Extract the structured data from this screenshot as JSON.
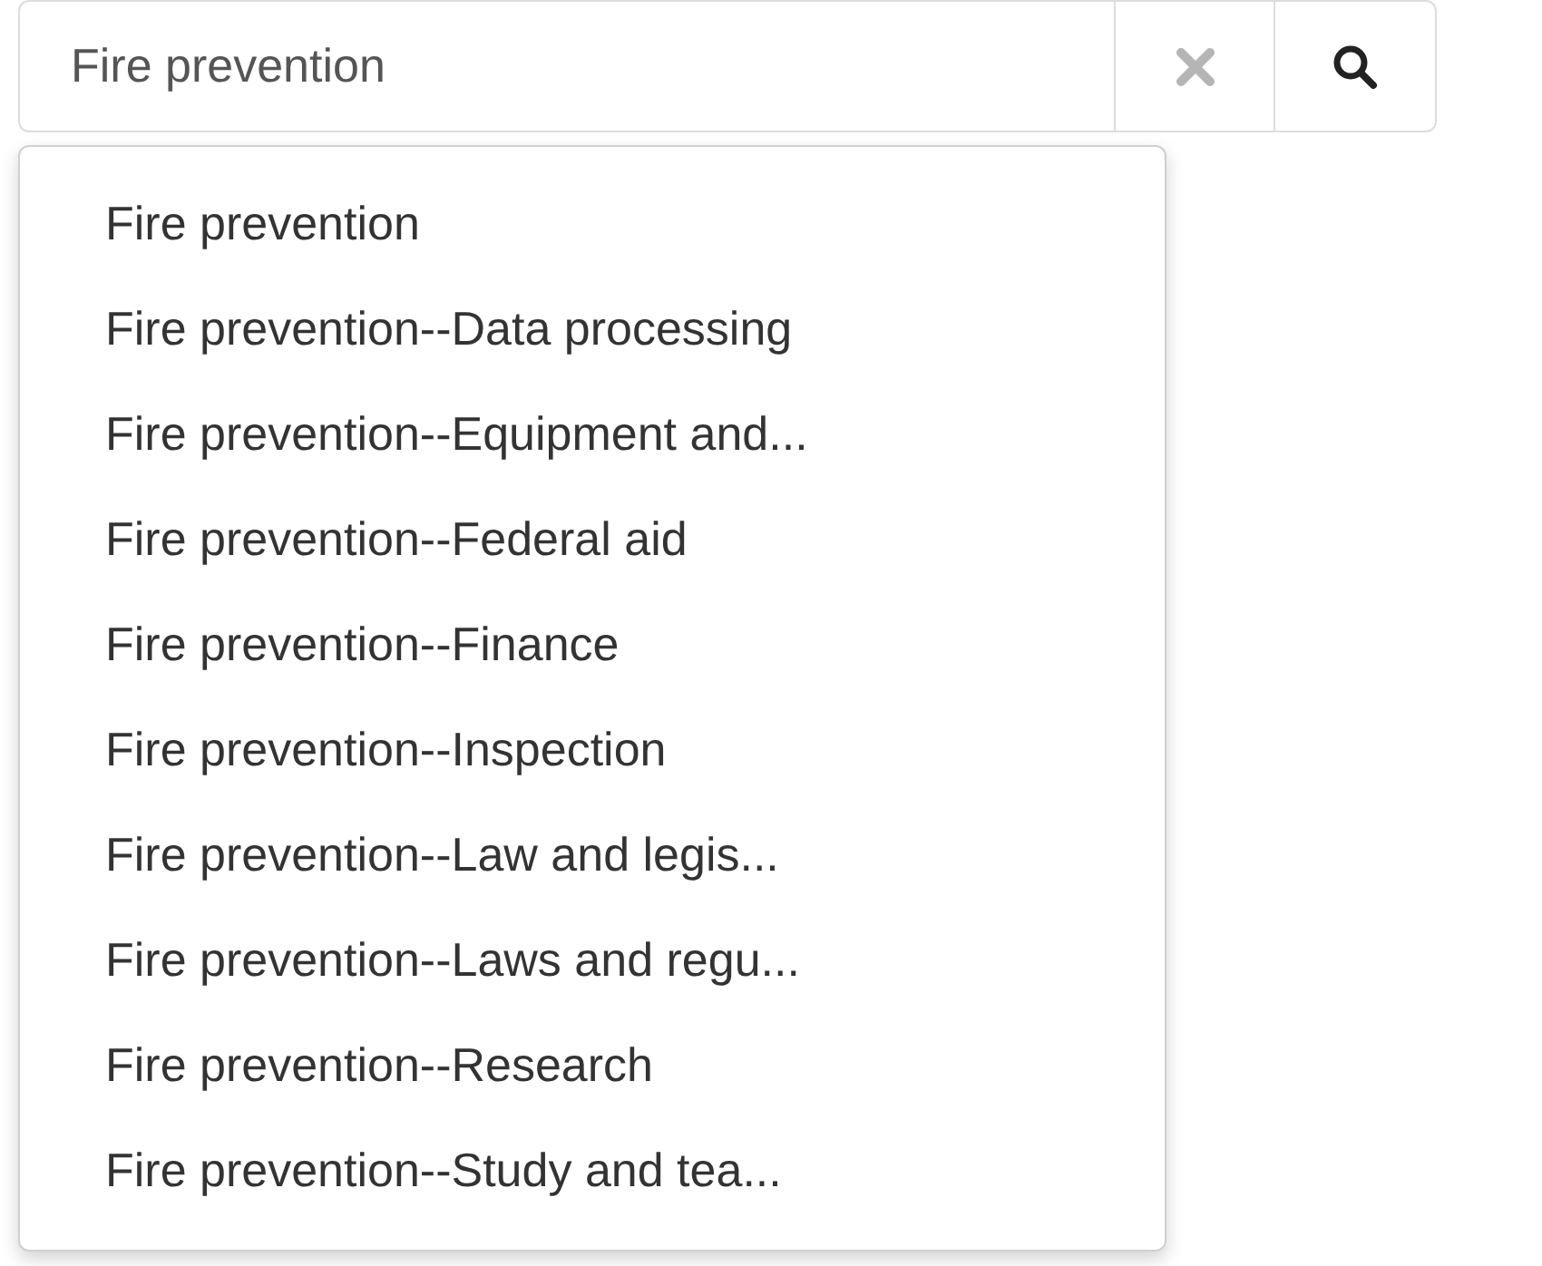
{
  "search": {
    "value": "Fire prevention"
  },
  "suggestions": [
    {
      "label": "Fire prevention"
    },
    {
      "label": "Fire prevention--Data processing"
    },
    {
      "label": "Fire prevention--Equipment and..."
    },
    {
      "label": "Fire prevention--Federal aid"
    },
    {
      "label": "Fire prevention--Finance"
    },
    {
      "label": "Fire prevention--Inspection"
    },
    {
      "label": "Fire prevention--Law and legis..."
    },
    {
      "label": "Fire prevention--Laws and regu..."
    },
    {
      "label": "Fire prevention--Research"
    },
    {
      "label": "Fire prevention--Study and tea..."
    }
  ]
}
